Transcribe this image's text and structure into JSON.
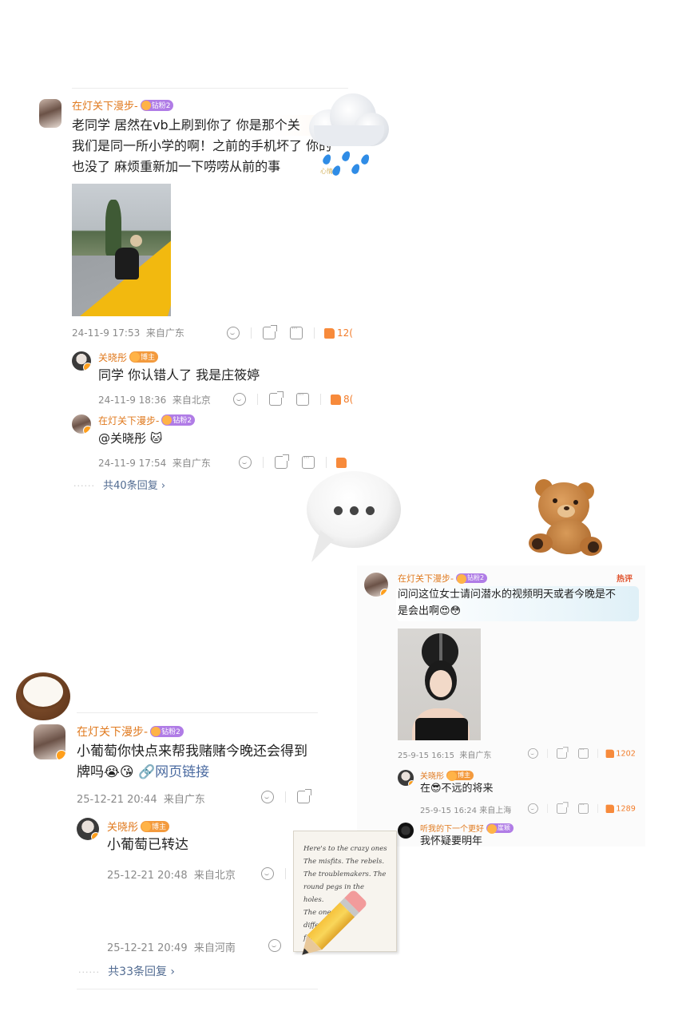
{
  "post1": {
    "username": "在灯关下漫步-",
    "tag": "钻粉2",
    "text_lines": [
      "老同学 居然在vb上刷到你了 你是那个关",
      "我们是同一所小学的啊！之前的手机坏了 你的",
      "也没了 麻烦重新加一下唠唠从前的事"
    ],
    "time": "24-11-9 17:53",
    "location": "来自广东",
    "likes": "12(",
    "replies": [
      {
        "username": "关晓彤",
        "tag": "博主",
        "text": "同学 你认错人了 我是庄筱婷",
        "time": "24-11-9 18:36",
        "location": "来自北京",
        "likes": "8("
      },
      {
        "username": "在灯关下漫步-",
        "tag": "钻粉2",
        "text": "@关晓彤 🐱",
        "time": "24-11-9 17:54",
        "location": "来自广东",
        "likes": ""
      }
    ],
    "more_replies": "共40条回复 ›"
  },
  "post2": {
    "username": "在灯关下漫步-",
    "tag": "钻粉2",
    "hot_badge": "热评",
    "text_lines": [
      "问问这位女士请问潜水的视频明天或者今晚是不",
      "是会出啊😍😳"
    ],
    "time": "25-9-15 16:15",
    "location": "来自广东",
    "likes": "1202",
    "replies": [
      {
        "username": "关晓彤",
        "tag": "博主",
        "text": "在😎不远的将来",
        "time": "25-9-15 16:24",
        "location": "来自上海",
        "likes": "1289"
      },
      {
        "username": "听我的下一个更好",
        "tag": "崖颖",
        "text": "我怀疑要明年"
      }
    ]
  },
  "post3": {
    "username": "在灯关下漫步-",
    "tag": "钻粉2",
    "text_line1": "小葡萄你快点来帮我赌赌今晚还会得到",
    "text_line2": "牌吗😭😘",
    "link_text": "🔗网页链接",
    "time": "25-12-21 20:44",
    "location": "来自广东",
    "replies": [
      {
        "username": "关晓彤",
        "tag": "博主",
        "text": "小葡萄已转达",
        "time": "25-12-21 20:48",
        "location": "来自北京"
      },
      {
        "time": "25-12-21 20:49",
        "location": "来自河南"
      }
    ],
    "more_replies": "共33条回复 ›"
  },
  "stickers": {
    "cloud_caption": "心情",
    "notes_lines": [
      "Here's to the crazy ones",
      "The misfits. The rebels.",
      "The troublemakers. The",
      "round pegs in the",
      "holes.",
      "The ones who",
      "differently",
      "fond of"
    ]
  },
  "colors": {
    "username": "#e07a1f",
    "link": "#516b91",
    "like": "#f27c2a",
    "meta": "#8a8a8a"
  }
}
